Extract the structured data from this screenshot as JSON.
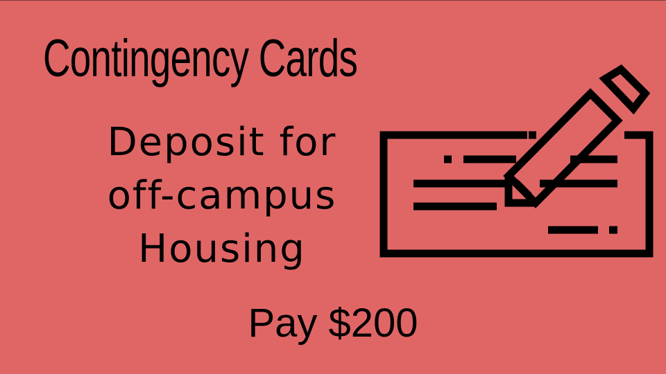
{
  "slide": {
    "title": "Contingency Cards",
    "card_name_lines": [
      "Deposit for",
      "off-campus",
      "Housing"
    ],
    "amount": "Pay $200",
    "icon": "check-and-pen-icon",
    "background_color": "#e06666",
    "text_color": "#000000"
  }
}
